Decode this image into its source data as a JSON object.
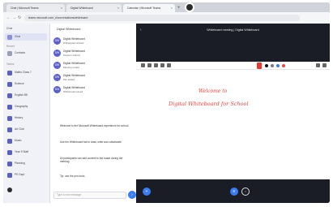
{
  "browser": {
    "tabs": [
      {
        "label": "Chat | Microsoft Teams"
      },
      {
        "label": "Digital Whiteboard"
      },
      {
        "label": "Calendar | Microsoft Teams"
      }
    ],
    "new_tab": "+",
    "url": "teams.microsoft.com/_#/conversations/whiteboard"
  },
  "sidebar": {
    "heading": "Chat",
    "recent_label": "Recent",
    "teams_label": "Teams",
    "pinned": [
      "Chat",
      "Contacts"
    ],
    "teams": [
      "Maths Class 7",
      "Science",
      "English 8B",
      "Geography",
      "History",
      "Art Club",
      "Music",
      "Year 9 Staff",
      "Planning",
      "PE Dept"
    ]
  },
  "chat": {
    "heading": "Digital Whiteboard",
    "messages": [
      {
        "initials": "DW",
        "name": "Digital Whiteboard",
        "text": "Whiteboard shared"
      },
      {
        "initials": "DW",
        "name": "Digital Whiteboard",
        "text": "Session started"
      },
      {
        "initials": "DW",
        "name": "Digital Whiteboard",
        "text": "Meeting ended"
      },
      {
        "initials": "DW",
        "name": "Digital Whiteboard",
        "text": "Tab added"
      },
      {
        "initials": "DW",
        "name": "Digital Whiteboard",
        "text": "Whiteboard saved"
      }
    ],
    "paragraphs": [
      "Welcome to the Microsoft Whiteboard experience for school.",
      "Use the Whiteboard tab to draw, write and collaborate.",
      "All participants can add content to the board during the meeting.",
      "Tip: use the pen tools."
    ],
    "compose_placeholder": "Type a new message",
    "send": "›"
  },
  "meeting": {
    "title": "Whiteboard meeting | Digital Whiteboard",
    "back": "‹",
    "whiteboard": {
      "line1": "Welcome to",
      "line2": "Digital Whiteboard for School"
    },
    "controls": {
      "left": "+",
      "center": "≡",
      "right": "○"
    }
  },
  "colors": {
    "accent": "#5b5fc7",
    "ink": "#e44444",
    "stage": "#1a1d26",
    "button": "#3b7cf0"
  },
  "icons": [
    "back-icon",
    "pen-icon",
    "eraser-icon",
    "color-swatch-icon",
    "send-icon",
    "menu-icon",
    "leave-icon"
  ]
}
